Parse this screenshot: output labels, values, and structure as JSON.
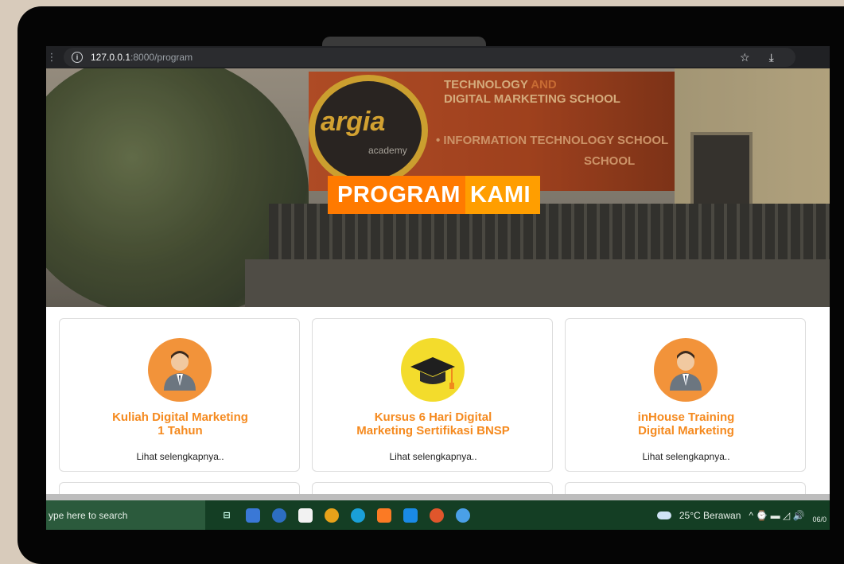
{
  "browser": {
    "url_host": "127.0.0.1",
    "url_path": ":8000/program",
    "menu_glyph": "⋮",
    "bookmark_glyph": "☆",
    "download_glyph": "⤓"
  },
  "hero": {
    "banner_line1_a": "TECHNOLOGY",
    "banner_line1_b": "AND",
    "banner_line2": "DIGITAL MARKETING SCHOOL",
    "banner_line3": "• INFORMATION TECHNOLOGY SCHOOL",
    "banner_line4": "SCHOOL",
    "logo_text": "argia",
    "logo_sub": "academy",
    "title_part1": "PROGRAM",
    "title_part2": "KAMI"
  },
  "cards": [
    {
      "title_line1": "Kuliah Digital Marketing",
      "title_line2": "1 Tahun",
      "link": "Lihat selengkapnya..",
      "icon": "person-icon",
      "icon_color": "#f2933a"
    },
    {
      "title_line1": "Kursus 6 Hari Digital",
      "title_line2": "Marketing Sertifikasi BNSP",
      "link": "Lihat selengkapnya..",
      "icon": "graduation-cap-icon",
      "icon_color": "#f3dc2c"
    },
    {
      "title_line1": "inHouse Training",
      "title_line2": "Digital Marketing",
      "link": "Lihat selengkapnya..",
      "icon": "person-icon",
      "icon_color": "#f2933a"
    }
  ],
  "taskbar": {
    "search_text": "ype here to search",
    "weather": "25°C  Berawan",
    "date": "06/0",
    "tray_glyphs": "^ ⌚ ▬ ◿ 🔊"
  },
  "colors": {
    "accent_orange": "#ff7a00",
    "accent_orange_light": "#ff9e00",
    "card_title": "#f58a1f",
    "taskbar_bg": "#143e24"
  }
}
